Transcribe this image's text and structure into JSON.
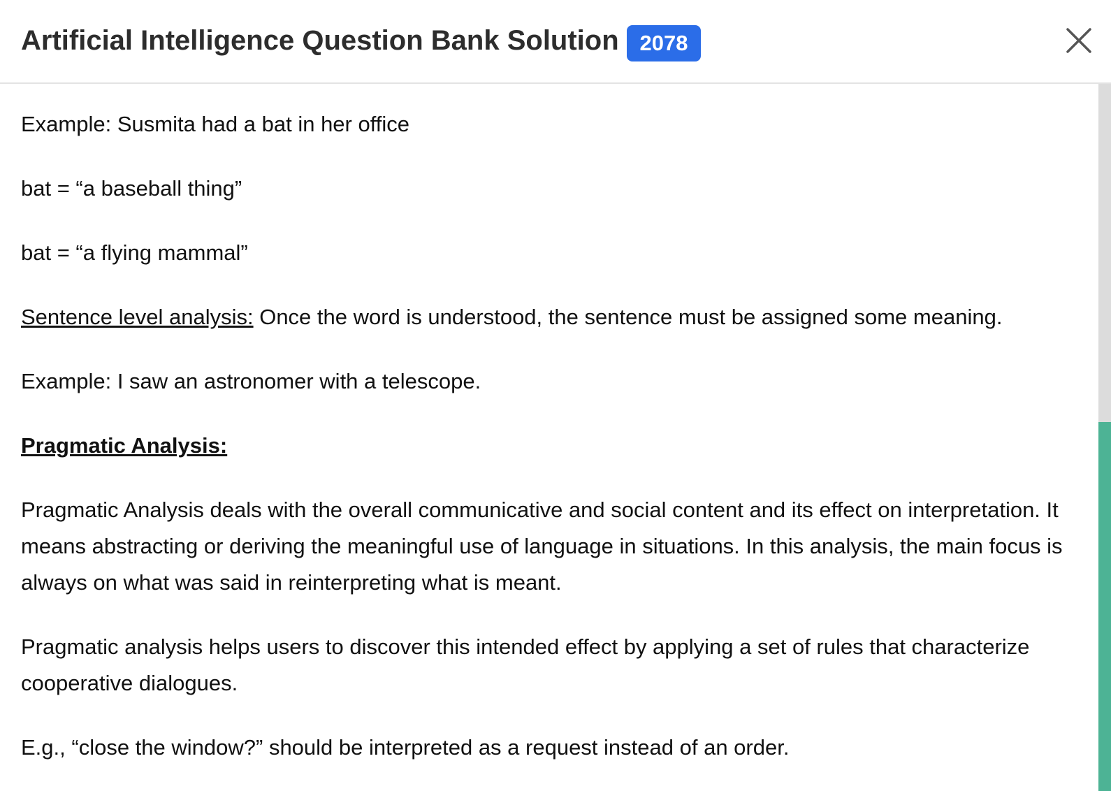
{
  "header": {
    "title": "Artificial Intelligence Question Bank Solution",
    "badge": "2078",
    "close_icon": "close-icon"
  },
  "content": {
    "p1": "Example: Susmita had a bat in her office",
    "p2": "bat = “a baseball thing”",
    "p3": "bat = “a flying mammal”",
    "p4_label": "Sentence level analysis:",
    "p4_text": " Once the word is understood, the sentence must be assigned some meaning.",
    "p5": "Example: I saw an astronomer with a telescope.",
    "heading": "Pragmatic Analysis:",
    "p6": "Pragmatic Analysis deals with the overall communicative and social content and its effect on interpretation. It means abstracting or deriving the meaningful use of language in situations. In this analysis, the main focus is always on what was said in reinterpreting what is meant.",
    "p7": "Pragmatic analysis helps users to discover this intended effect by applying a set of rules that characterize cooperative dialogues.",
    "p8": "E.g., “close the window?” should be interpreted as a request instead of an order."
  },
  "colors": {
    "badge": "#2b6de8",
    "scrollbar_thumb": "#4db395",
    "scrollbar_track": "#dcdcdc"
  }
}
